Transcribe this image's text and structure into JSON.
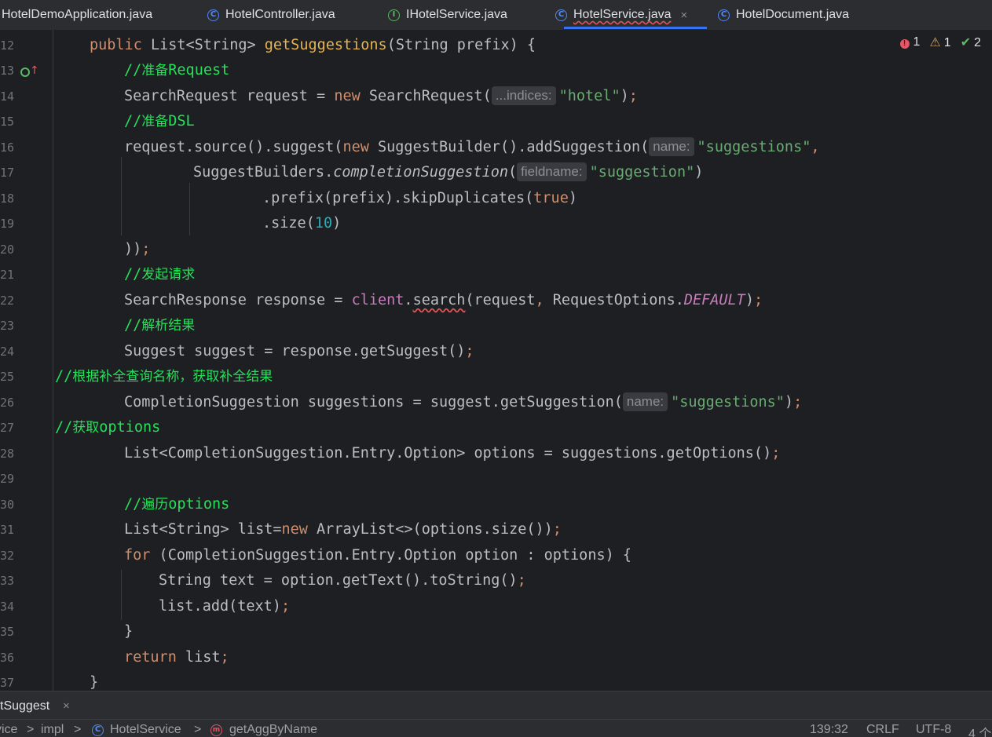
{
  "tabs": [
    {
      "label": "HotelDemoApplication.java",
      "icon": "java-file-icon"
    },
    {
      "label": "HotelController.java",
      "icon": "class-icon"
    },
    {
      "label": "IHotelService.java",
      "icon": "interface-icon"
    },
    {
      "label": "HotelService.java",
      "icon": "class-icon",
      "active": true,
      "close": "×"
    },
    {
      "label": "HotelDocument.java",
      "icon": "class-icon"
    }
  ],
  "inspection": {
    "errors": "1",
    "warnings": "1",
    "ok": "2"
  },
  "lines": [
    {
      "n": "12"
    },
    {
      "n": "13"
    },
    {
      "n": "14"
    },
    {
      "n": "15"
    },
    {
      "n": "16"
    },
    {
      "n": "17"
    },
    {
      "n": "18"
    },
    {
      "n": "19"
    },
    {
      "n": "20"
    },
    {
      "n": "21"
    },
    {
      "n": "22"
    },
    {
      "n": "23"
    },
    {
      "n": "24"
    },
    {
      "n": "25"
    },
    {
      "n": "26"
    },
    {
      "n": "27"
    },
    {
      "n": "28"
    },
    {
      "n": "29"
    },
    {
      "n": "30"
    },
    {
      "n": "31"
    },
    {
      "n": "32"
    },
    {
      "n": "33"
    },
    {
      "n": "34"
    },
    {
      "n": "35"
    },
    {
      "n": "36"
    },
    {
      "n": "37"
    }
  ],
  "code": {
    "l12": [
      "public",
      " List<String> ",
      "getSuggestions",
      "(String prefix) {"
    ],
    "l13": [
      "//",
      "准备",
      "Request"
    ],
    "l14": [
      "SearchRequest request = ",
      "new",
      " SearchRequest(",
      "...indices:",
      "\"hotel\"",
      ")",
      ";"
    ],
    "l15": [
      "//",
      "准备",
      "DSL"
    ],
    "l16": [
      "request.source().suggest(",
      "new",
      " SuggestBuilder().addSuggestion(",
      "name:",
      "\"suggestions\"",
      ","
    ],
    "l17": [
      "SuggestBuilders.",
      "completionSuggestion",
      "(",
      "fieldname:",
      "\"suggestion\"",
      ")"
    ],
    "l18": [
      ".prefix(prefix).skipDuplicates(",
      "true",
      ")"
    ],
    "l19": [
      ".size(",
      "10",
      ")"
    ],
    "l20": [
      "))",
      ";"
    ],
    "l21": [
      "//",
      "发起请求"
    ],
    "l22": [
      "SearchResponse response = ",
      "client",
      ".",
      "search",
      "(request",
      ",",
      " RequestOptions.",
      "DEFAULT",
      ")",
      ";"
    ],
    "l23": [
      "//",
      "解析结果"
    ],
    "l24": [
      "Suggest suggest = response.getSuggest()",
      ";"
    ],
    "l25": [
      "//",
      "根据补全查询名称，获取补全结果"
    ],
    "l26": [
      "CompletionSuggestion suggestions = suggest.getSuggestion(",
      "name:",
      "\"suggestions\"",
      ")",
      ";"
    ],
    "l27": [
      "//",
      "获取",
      "options"
    ],
    "l28": [
      "List<CompletionSuggestion.Entry.Option> options = suggestions.getOptions()",
      ";"
    ],
    "l30": [
      "//",
      "遍历",
      "options"
    ],
    "l31": [
      "List<String> list=",
      "new",
      " ArrayList<>(options.size())",
      ";"
    ],
    "l32": [
      "for",
      " (CompletionSuggestion.Entry.Option option : options) {"
    ],
    "l33": [
      "String text = option.getText().toString()",
      ";"
    ],
    "l34": [
      "list.add(text)",
      ";"
    ],
    "l35": [
      "}"
    ],
    "l36": [
      "return",
      " list",
      ";"
    ],
    "l37": [
      "}"
    ]
  },
  "bottom": {
    "tab_label": "tSuggest",
    "close": "×"
  },
  "status": {
    "crumb1": "vice",
    "sep": ">",
    "crumb2": "impl",
    "crumb3": "HotelService",
    "crumb4": "getAggByName",
    "position": "139:32",
    "line_sep": "CRLF",
    "encoding": "UTF-8",
    "indent": "4 个"
  },
  "colors": {
    "bg": "#1e1f22",
    "keyword": "#cf8e6d",
    "string": "#6aab73",
    "comment": "#26e05a",
    "number": "#2aacb8",
    "accent": "#3574f0"
  }
}
